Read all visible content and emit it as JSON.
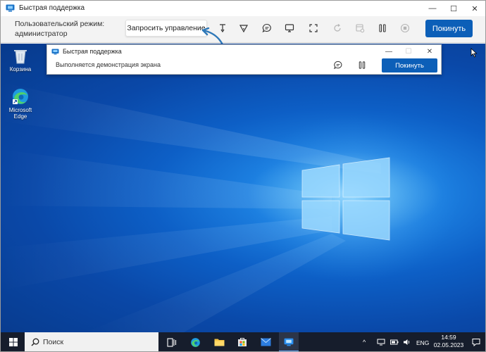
{
  "window": {
    "title": "Быстрая поддержка",
    "controls": {
      "minimize": "—",
      "maximize": "☐",
      "close": "✕"
    }
  },
  "toolbar": {
    "mode_line1": "Пользовательский режим:",
    "mode_line2": "администратор",
    "request_control_label": "Запросить управление",
    "leave_label": "Покинуть",
    "icons": [
      "annotate-icon",
      "laser-pointer-icon",
      "chat-icon",
      "select-monitor-icon",
      "fullscreen-icon",
      "restart-icon",
      "task-manager-icon",
      "pause-icon",
      "stop-icon"
    ]
  },
  "desktop": {
    "icons": [
      {
        "label": "Корзина"
      },
      {
        "label_line1": "Microsoft",
        "label_line2": "Edge"
      }
    ]
  },
  "shared_window": {
    "title": "Быстрая поддержка",
    "status": "Выполняется демонстрация экрана",
    "leave_label": "Покинуть",
    "controls": {
      "minimize": "—",
      "maximize": "☐",
      "close": "✕"
    }
  },
  "taskbar": {
    "search_label": "Поиск",
    "language": "ENG",
    "time": "14:59",
    "date": "02.05.2023"
  },
  "colors": {
    "accent": "#0c5fb8",
    "desktop_blue": "#0d5fc6",
    "taskbar": "#161d2c",
    "arrow": "#2e78b8"
  }
}
